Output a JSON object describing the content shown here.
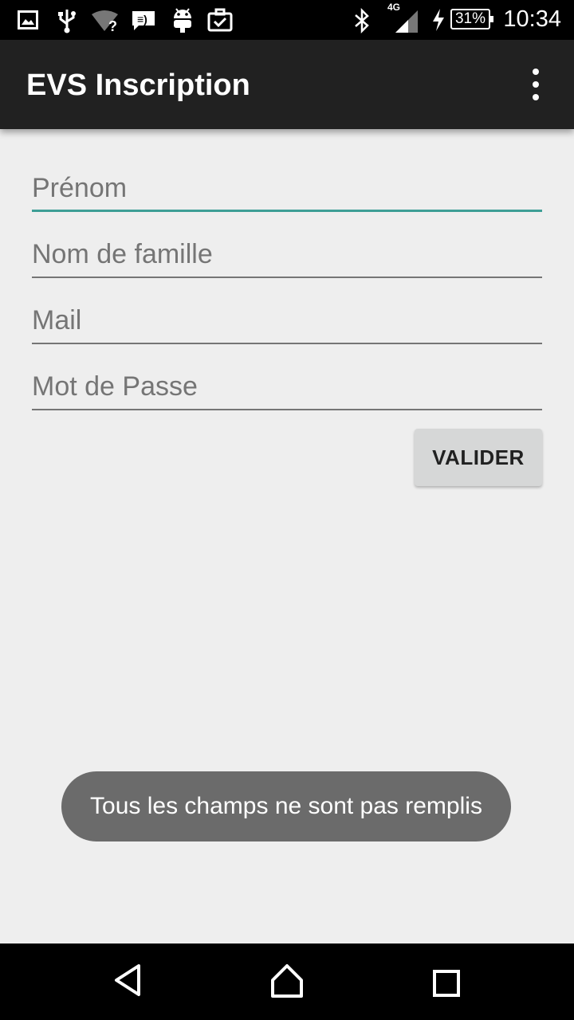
{
  "status_bar": {
    "time": "10:34",
    "battery": "31%",
    "network": "4G",
    "icons": [
      "image-icon",
      "usb-icon",
      "wifi-question-icon",
      "message-icon",
      "android-icon",
      "briefcase-check-icon",
      "bluetooth-icon",
      "signal-icon",
      "charging-icon"
    ]
  },
  "app_bar": {
    "title": "EVS Inscription"
  },
  "form": {
    "first_name_placeholder": "Prénom",
    "last_name_placeholder": "Nom de famille",
    "mail_placeholder": "Mail",
    "password_placeholder": "Mot de Passe",
    "submit_label": "VALIDER"
  },
  "toast": {
    "message": "Tous les champs ne sont pas remplis"
  },
  "colors": {
    "accent": "#3d9e96",
    "app_bar": "#212121",
    "background": "#eeeeee"
  }
}
